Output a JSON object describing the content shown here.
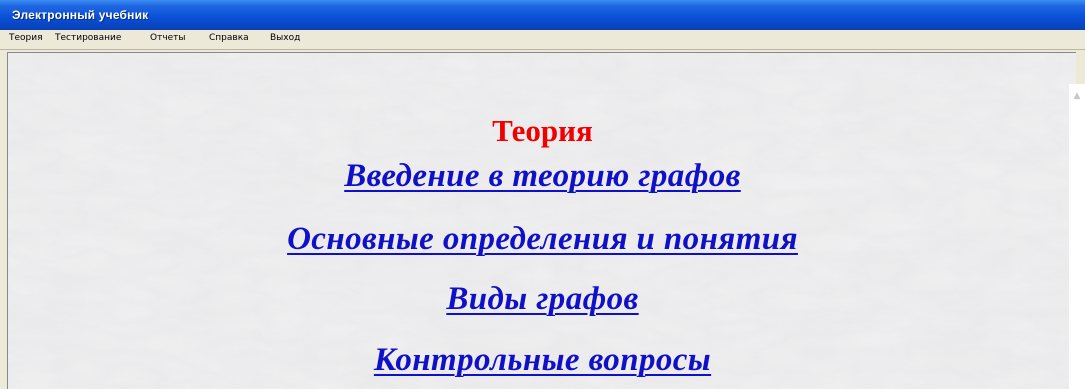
{
  "window": {
    "title": "Электронный учебник"
  },
  "menu": {
    "items": [
      {
        "label": "Теория"
      },
      {
        "label": "Тестирование"
      },
      {
        "label": "Отчеты"
      },
      {
        "label": "Справка"
      },
      {
        "label": "Выход"
      }
    ]
  },
  "main": {
    "heading": "Теория",
    "links": [
      {
        "label": "Введение в теорию графов"
      },
      {
        "label": "Основные определения и понятия"
      },
      {
        "label": "Виды графов"
      },
      {
        "label": "Контрольные вопросы"
      }
    ]
  },
  "colors": {
    "title_bar": "#0a52d8",
    "heading": "#f00000",
    "link": "#1010c8",
    "menubar": "#ece9d8"
  },
  "icons": {
    "scroll_up": "scroll-up-arrow-icon"
  }
}
